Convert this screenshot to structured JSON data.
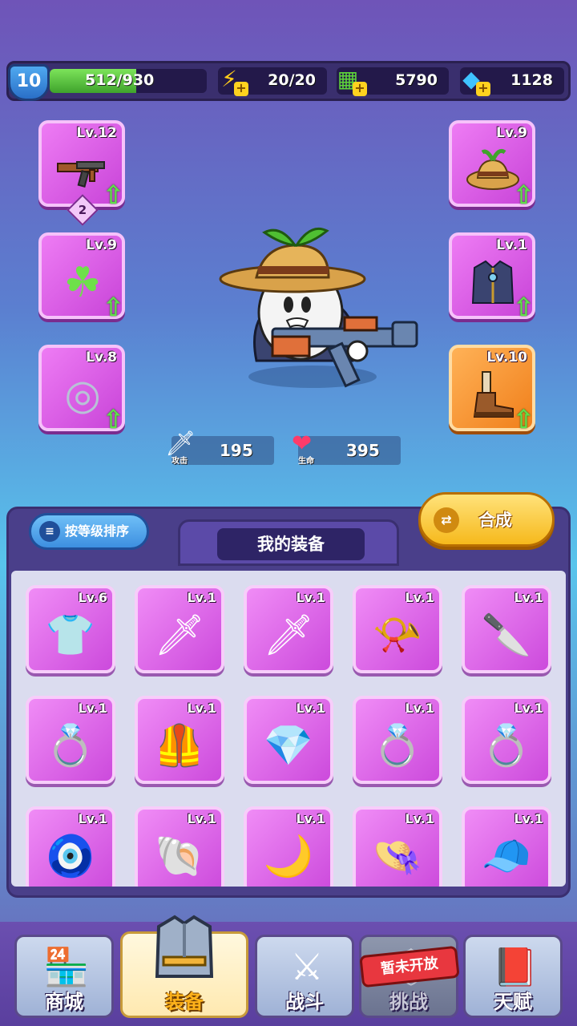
{
  "player": {
    "level": "10",
    "xp_text": "512/930",
    "xp_fraction": 0.55
  },
  "resources": {
    "energy": "20/20",
    "cash": "5790",
    "gems": "1128"
  },
  "equipped": {
    "weapon": {
      "level": "Lv.12",
      "stars": "2",
      "icon": "rifle-icon"
    },
    "necklace": {
      "level": "Lv.9",
      "icon": "clover-necklace-icon"
    },
    "ring": {
      "level": "Lv.8",
      "icon": "ring-icon"
    },
    "hat": {
      "level": "Lv.9",
      "icon": "straw-hat-icon"
    },
    "armor": {
      "level": "Lv.1",
      "icon": "coat-icon"
    },
    "boots": {
      "level": "Lv.10",
      "icon": "boots-icon"
    }
  },
  "stats": {
    "attack_label": "攻击",
    "attack": "195",
    "hp_label": "生命",
    "hp": "395"
  },
  "panel": {
    "sort_label": "按等级排序",
    "title": "我的装备",
    "merge_label": "合成"
  },
  "inventory": [
    {
      "level": "Lv.6",
      "icon": "jersey-icon"
    },
    {
      "level": "Lv.1",
      "icon": "sword-icon"
    },
    {
      "level": "Lv.1",
      "icon": "sword-icon"
    },
    {
      "level": "Lv.1",
      "icon": "horn-icon"
    },
    {
      "level": "Lv.1",
      "icon": "kunai-icon"
    },
    {
      "level": "Lv.1",
      "icon": "gold-ring-icon"
    },
    {
      "level": "Lv.1",
      "icon": "gold-armor-icon"
    },
    {
      "level": "Lv.1",
      "icon": "diamond-ring-icon"
    },
    {
      "level": "Lv.1",
      "icon": "ruby-ring-icon"
    },
    {
      "level": "Lv.1",
      "icon": "amethyst-ring-icon"
    },
    {
      "level": "Lv.1",
      "icon": "sapphire-amulet-icon"
    },
    {
      "level": "Lv.1",
      "icon": "shell-necklace-icon"
    },
    {
      "level": "Lv.1",
      "icon": "moon-necklace-icon"
    },
    {
      "level": "Lv.1",
      "icon": "straw-hat-icon"
    },
    {
      "level": "Lv.1",
      "icon": "red-cap-icon"
    }
  ],
  "nav": {
    "shop": "商城",
    "equip": "装备",
    "battle": "战斗",
    "challenge": "挑战",
    "challenge_tag": "暂未开放",
    "talent": "天赋"
  },
  "colors": {
    "item_rare": "#d64fe2",
    "item_epic": "#f28f2a",
    "upgrade_arrow": "#5fe04a",
    "active_tab": "#ffb21a"
  }
}
